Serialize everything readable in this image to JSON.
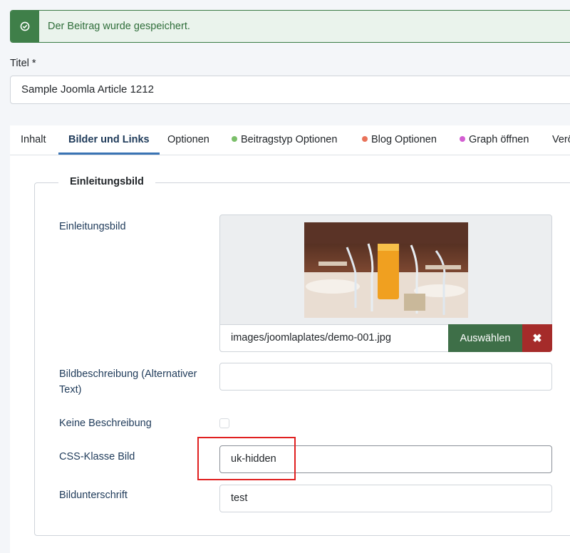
{
  "alert": {
    "message": "Der Beitrag wurde gespeichert.",
    "icon": "check-circle-icon",
    "color": "#3f7f49"
  },
  "title": {
    "label": "Titel *",
    "value": "Sample Joomla Article 1212"
  },
  "tabs": [
    {
      "label": "Inhalt"
    },
    {
      "label": "Bilder und Links",
      "active": true
    },
    {
      "label": "Optionen"
    },
    {
      "label": "Beitragstyp Optionen",
      "dot_color": "#7bbf6a"
    },
    {
      "label": "Blog Optionen",
      "dot_color": "#e9735a"
    },
    {
      "label": "Graph öffnen",
      "dot_color": "#d35ed2"
    },
    {
      "label": "Verö"
    }
  ],
  "intro_image": {
    "legend": "Einleitungsbild",
    "image_label": "Einleitungsbild",
    "image_path": "images/joomlaplates/demo-001.jpg",
    "select_button": "Auswählen",
    "clear_icon": "close-icon",
    "alt_label": "Bildbeschreibung (Alternativer Text)",
    "alt_value": "",
    "no_desc_label": "Keine Beschreibung",
    "no_desc_checked": false,
    "css_class_label": "CSS-Klasse Bild",
    "css_class_value": "uk-hidden",
    "caption_label": "Bildunterschrift",
    "caption_value": "test"
  }
}
